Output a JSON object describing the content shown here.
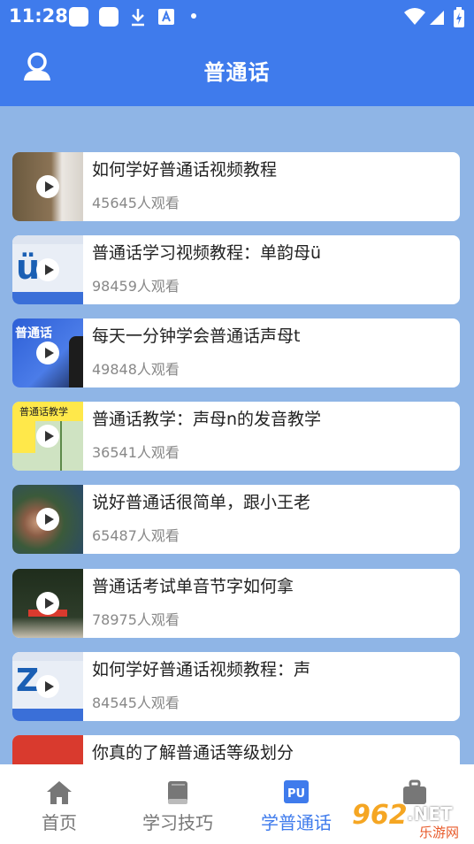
{
  "status_bar": {
    "time": "11:28"
  },
  "header": {
    "title": "普通话"
  },
  "videos": [
    {
      "title": "如何学好普通话视频教程",
      "views": "45645人观看"
    },
    {
      "title": "普通话学习视频教程：单韵母ü",
      "views": "98459人观看"
    },
    {
      "title": "每天一分钟学会普通话声母t",
      "views": "49848人观看"
    },
    {
      "title": "普通话教学：声母n的发音教学",
      "views": "36541人观看"
    },
    {
      "title": "说好普通话很简单，跟小王老",
      "views": "65487人观看"
    },
    {
      "title": "普通话考试单音节字如何拿",
      "views": "78975人观看"
    },
    {
      "title": "如何学好普通话视频教程：声",
      "views": "84545人观看"
    },
    {
      "title": "你真的了解普通话等级划分",
      "views": ""
    }
  ],
  "thumbs": [
    {
      "text": "",
      "color": "#6b5a3f"
    },
    {
      "text": "ü",
      "color": "#e9eef6"
    },
    {
      "text": "普通话",
      "color": "#2d5fd6"
    },
    {
      "text": "普通话教学",
      "color": "#ffe84a"
    },
    {
      "text": "",
      "color": "#3b5a3a"
    },
    {
      "text": "",
      "color": "#1f2d1c"
    },
    {
      "text": "Z",
      "color": "#e9eef6"
    },
    {
      "text": "",
      "color": "#d93a2e"
    }
  ],
  "tabs": [
    {
      "label": "首页",
      "active": false
    },
    {
      "label": "学习技巧",
      "active": false
    },
    {
      "label": "学普通话",
      "active": true
    },
    {
      "label": "",
      "active": false
    }
  ],
  "tab_icon_text": "PU",
  "watermark": {
    "main": "962",
    "suffix": ".NET",
    "sub": "乐游网"
  },
  "colors": {
    "primary": "#3f7bec",
    "background": "#8fb5e6"
  }
}
